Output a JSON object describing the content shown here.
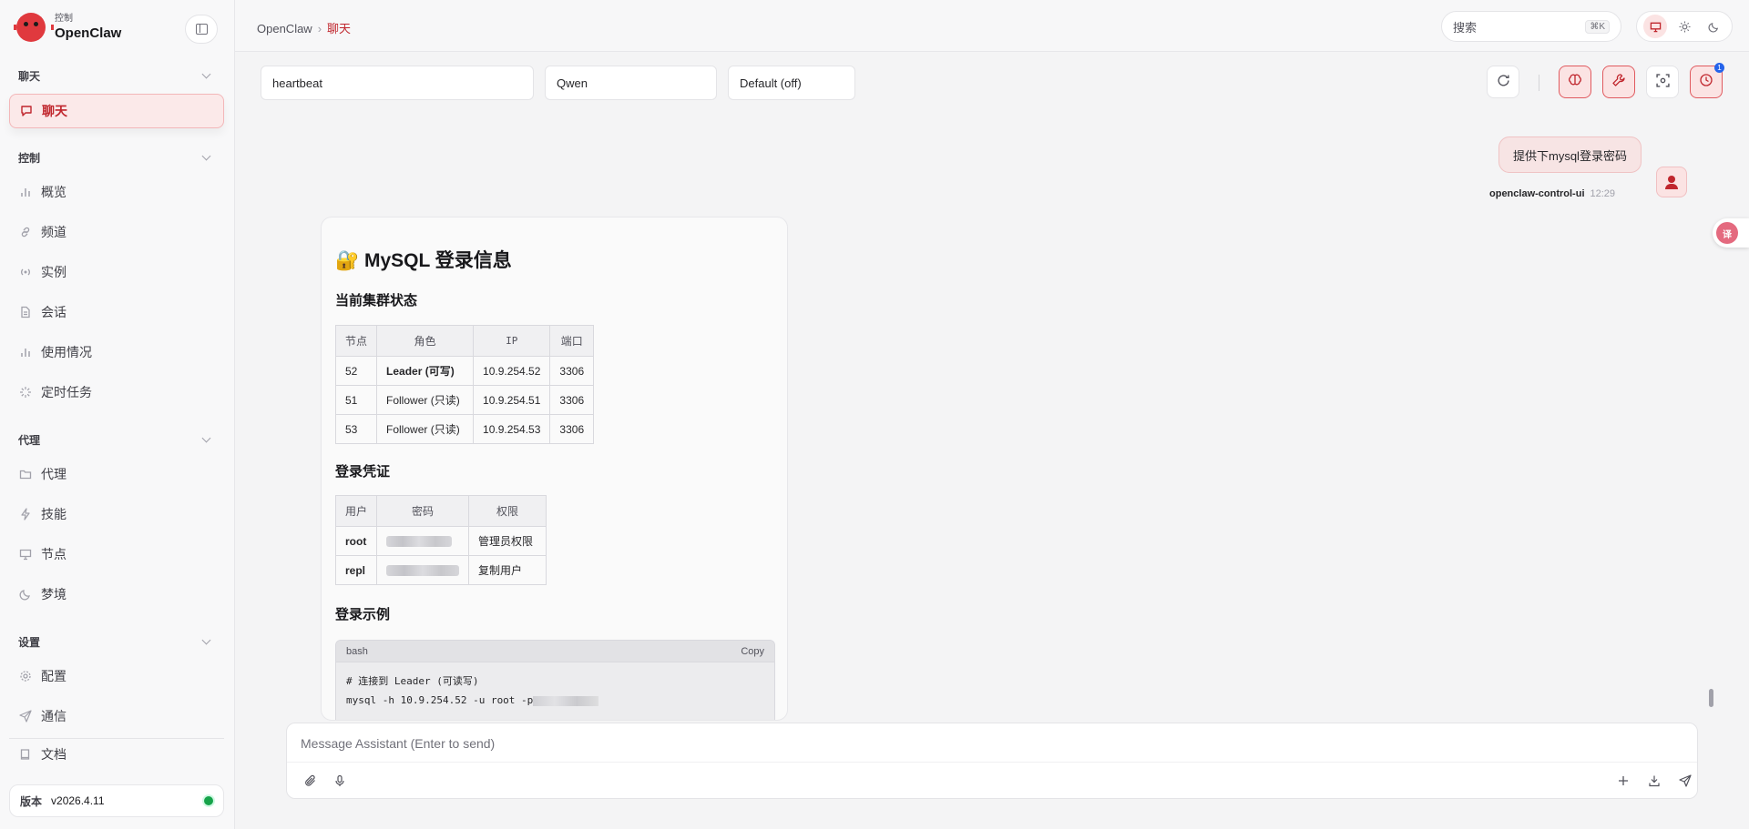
{
  "brand": {
    "sub": "控制",
    "title": "OpenClaw"
  },
  "sidebar": {
    "sections": [
      {
        "label": "聊天"
      },
      {
        "label": "控制"
      },
      {
        "label": "代理"
      },
      {
        "label": "设置"
      }
    ],
    "items": [
      {
        "label": "聊天",
        "icon": "chat-icon"
      },
      {
        "label": "概览",
        "icon": "bar-chart-icon"
      },
      {
        "label": "频道",
        "icon": "link-icon"
      },
      {
        "label": "实例",
        "icon": "radio-icon"
      },
      {
        "label": "会话",
        "icon": "document-icon"
      },
      {
        "label": "使用情况",
        "icon": "bar-chart-icon"
      },
      {
        "label": "定时任务",
        "icon": "loader-icon"
      },
      {
        "label": "代理",
        "icon": "folder-icon"
      },
      {
        "label": "技能",
        "icon": "lightning-icon"
      },
      {
        "label": "节点",
        "icon": "monitor-icon"
      },
      {
        "label": "梦境",
        "icon": "moon-icon"
      },
      {
        "label": "配置",
        "icon": "gear-icon"
      },
      {
        "label": "通信",
        "icon": "send-icon"
      },
      {
        "label": "文档",
        "icon": "book-icon"
      }
    ],
    "version_label": "版本",
    "version_value": "v2026.4.11"
  },
  "topbar": {
    "breadcrumb_root": "OpenClaw",
    "breadcrumb_sep": "›",
    "breadcrumb_current": "聊天",
    "search_label": "搜索",
    "search_shortcut": "⌘K"
  },
  "controls": {
    "session": "heartbeat",
    "model": "Qwen",
    "thinking": "Default (off)",
    "notification_count": "1"
  },
  "chat": {
    "user_message": "提供下mysql登录密码",
    "user_name": "openclaw-control-ui",
    "user_time": "12:29",
    "translate_badge": "译",
    "assistant": {
      "title_emoji": "🔐",
      "title": "MySQL 登录信息",
      "cluster_heading": "当前集群状态",
      "cluster_headers": [
        "节点",
        "角色",
        "IP",
        "端口"
      ],
      "cluster_rows": [
        [
          "52",
          "Leader (可写)",
          "10.9.254.52",
          "3306"
        ],
        [
          "51",
          "Follower (只读)",
          "10.9.254.51",
          "3306"
        ],
        [
          "53",
          "Follower (只读)",
          "10.9.254.53",
          "3306"
        ]
      ],
      "cred_heading": "登录凭证",
      "cred_headers": [
        "用户",
        "密码",
        "权限"
      ],
      "cred_rows": [
        [
          "root",
          "管理员权限"
        ],
        [
          "repl",
          "复制用户"
        ]
      ],
      "example_heading": "登录示例",
      "code_lang": "bash",
      "code_copy": "Copy",
      "code_line1": "# 连接到 Leader (可读写)",
      "code_line2": "mysql -h 10.9.254.52 -u root -p"
    }
  },
  "composer": {
    "placeholder": "Message Assistant (Enter to send)"
  },
  "colors": {
    "accent": "#c0262d",
    "accent_bg": "#fbe3e3",
    "status_ok": "#16a34a"
  }
}
